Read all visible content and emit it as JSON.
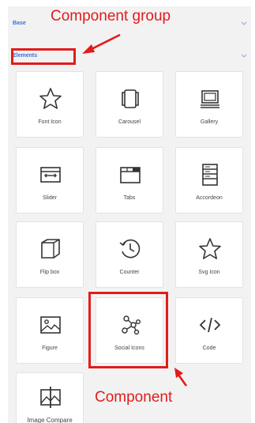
{
  "sections": {
    "base": {
      "label": "Base"
    },
    "elements": {
      "label": "Elements"
    }
  },
  "tiles": [
    {
      "label": "Font Icon",
      "icon": "star-icon"
    },
    {
      "label": "Carousel",
      "icon": "carousel-icon"
    },
    {
      "label": "Gallery",
      "icon": "gallery-icon"
    },
    {
      "label": "Slider",
      "icon": "slider-icon"
    },
    {
      "label": "Tabs",
      "icon": "tabs-icon"
    },
    {
      "label": "Accordeon",
      "icon": "accordion-icon"
    },
    {
      "label": "Flip box",
      "icon": "flip-box-icon"
    },
    {
      "label": "Counter",
      "icon": "counter-icon"
    },
    {
      "label": "Svg Icon",
      "icon": "star-icon"
    },
    {
      "label": "Figure",
      "icon": "image-icon"
    },
    {
      "label": "Social Icons",
      "icon": "social-network-icon"
    },
    {
      "label": "Code",
      "icon": "code-icon"
    },
    {
      "label": "Image Compare",
      "icon": "image-compare-icon"
    }
  ],
  "annotations": {
    "group": "Component group",
    "component": "Component"
  },
  "colors": {
    "accent": "#3d6fd6",
    "annotation_red": "#e31b1b",
    "panel_bg": "#f2f2f2",
    "tile_bg": "#ffffff"
  }
}
